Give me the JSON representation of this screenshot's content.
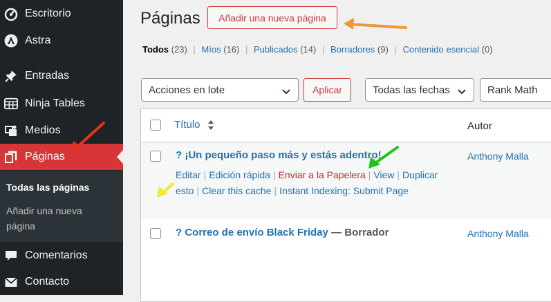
{
  "sidebar": {
    "items": [
      {
        "label": "Escritorio",
        "icon": "dashboard-icon"
      },
      {
        "label": "Astra",
        "icon": "astra-icon"
      },
      {
        "label": "Entradas",
        "icon": "pushpin-icon"
      },
      {
        "label": "Ninja Tables",
        "icon": "table-icon"
      },
      {
        "label": "Medios",
        "icon": "media-icon"
      },
      {
        "label": "Páginas",
        "icon": "pages-icon"
      },
      {
        "label": "Comentarios",
        "icon": "comment-icon"
      },
      {
        "label": "Contacto",
        "icon": "mail-icon"
      }
    ],
    "submenu": {
      "current": "Todas las páginas",
      "add_new": "Añadir una nueva página"
    }
  },
  "header": {
    "title": "Páginas",
    "add_new_label": "Añadir una nueva página"
  },
  "filters": {
    "all": {
      "label": "Todos",
      "count": "(23)"
    },
    "mine": {
      "label": "Míos",
      "count": "(16)"
    },
    "published": {
      "label": "Publicados",
      "count": "(14)"
    },
    "drafts": {
      "label": "Borradores",
      "count": "(9)"
    },
    "essential": {
      "label": "Contenido esencial",
      "count": "(0)"
    },
    "separator": "|"
  },
  "toolbar": {
    "bulk_actions": "Acciones en lote",
    "apply": "Aplicar",
    "dates": "Todas las fechas",
    "seo": "Rank Math"
  },
  "table": {
    "col_title": "Título",
    "col_author": "Autor",
    "rows": [
      {
        "title": "? ¡Un pequeño paso más y estás adentro!",
        "author": "Anthony Malla",
        "actions": {
          "edit": "Editar",
          "quick_edit": "Edición rápida",
          "trash": "Enviar a la Papelera",
          "view": "View",
          "duplicate": "Duplicar",
          "duplicate_cont": "esto",
          "clear_cache": "Clear this cache",
          "indexing": "Instant Indexing: Submit Page"
        }
      },
      {
        "title": "? Correo de envío Black Friday",
        "state": "— Borrador",
        "author": "Anthony Malla"
      }
    ]
  },
  "annotations": {
    "arrow_colors": {
      "red": "#e8311f",
      "orange": "#f0953a",
      "green": "#1fc41f",
      "yellow": "#f2ea2c"
    }
  },
  "colors": {
    "sidebar_bg": "#1d2327",
    "active_bg": "#d63638",
    "link": "#2271b1",
    "accent_red": "#d63638"
  }
}
